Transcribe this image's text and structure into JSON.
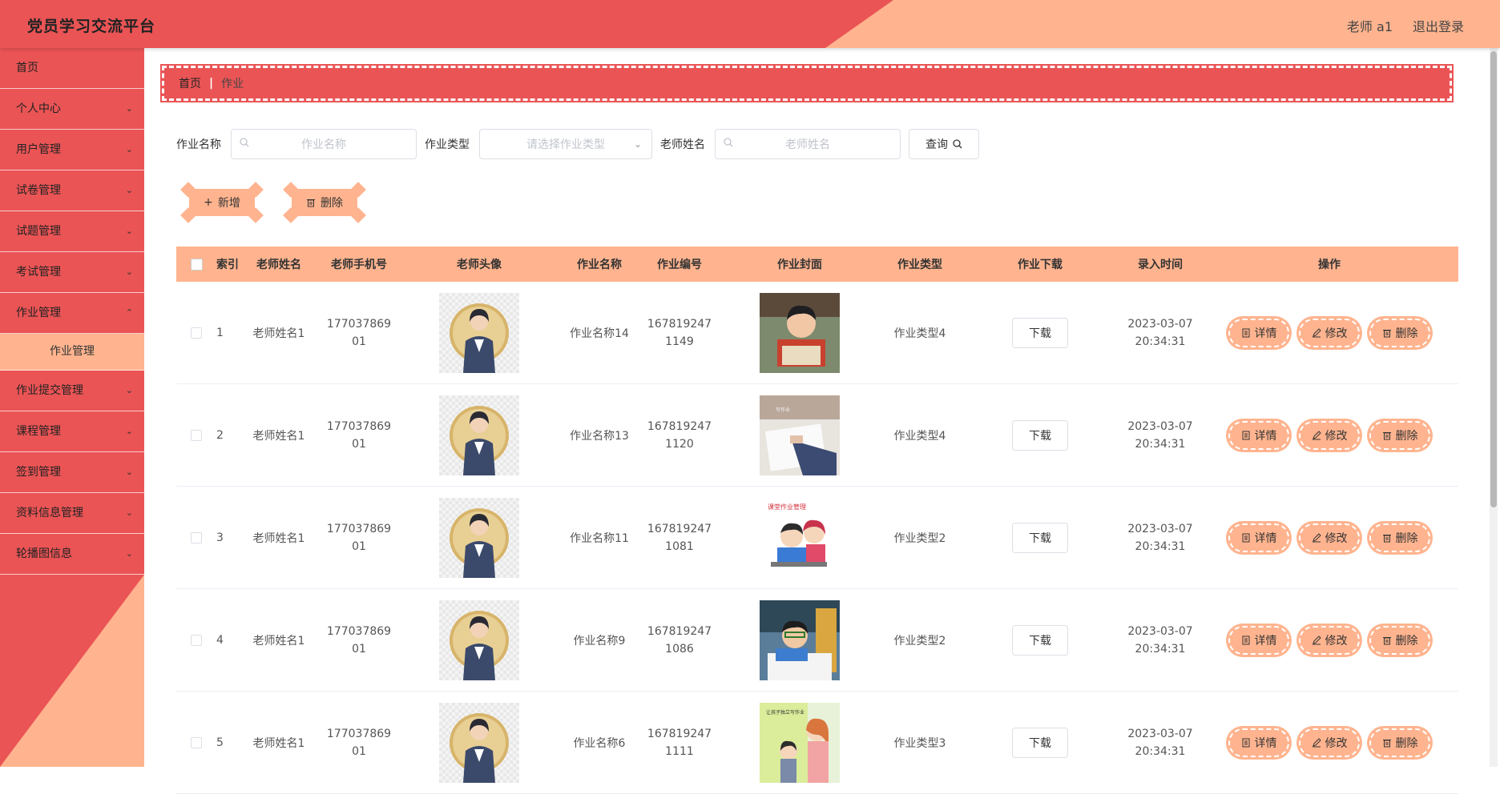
{
  "header": {
    "app_title": "党员学习交流平台",
    "user_label": "老师 a1",
    "logout_label": "退出登录"
  },
  "sidebar": {
    "items": [
      {
        "label": "首页",
        "has_children": false
      },
      {
        "label": "个人中心",
        "has_children": true
      },
      {
        "label": "用户管理",
        "has_children": true
      },
      {
        "label": "试卷管理",
        "has_children": true
      },
      {
        "label": "试题管理",
        "has_children": true
      },
      {
        "label": "考试管理",
        "has_children": true
      },
      {
        "label": "作业管理",
        "has_children": true,
        "expanded": true
      },
      {
        "label": "作业提交管理",
        "has_children": true
      },
      {
        "label": "课程管理",
        "has_children": true
      },
      {
        "label": "签到管理",
        "has_children": true
      },
      {
        "label": "资料信息管理",
        "has_children": true
      },
      {
        "label": "轮播图信息",
        "has_children": true
      }
    ],
    "active_sub_item": "作业管理"
  },
  "breadcrumb": {
    "home": "首页",
    "separator": "|",
    "current": "作业"
  },
  "search": {
    "hw_name_label": "作业名称",
    "hw_name_placeholder": "作业名称",
    "hw_type_label": "作业类型",
    "hw_type_placeholder": "请选择作业类型",
    "teacher_name_label": "老师姓名",
    "teacher_name_placeholder": "老师姓名",
    "query_label": "查询"
  },
  "actions": {
    "add_label": "新增",
    "delete_label": "删除"
  },
  "table": {
    "columns": [
      "索引",
      "老师姓名",
      "老师手机号",
      "老师头像",
      "作业名称",
      "作业编号",
      "作业封面",
      "作业类型",
      "作业下载",
      "录入时间",
      "操作"
    ],
    "download_label": "下载",
    "detail_label": "详情",
    "edit_label": "修改",
    "remove_label": "删除",
    "rows": [
      {
        "index": "1",
        "teacher": "老师姓名1",
        "phone": "177037869\n01",
        "hw_name": "作业名称14",
        "hw_no": "167819247\n1149",
        "hw_type": "作业类型4",
        "time": "2023-03-07\n20:34:31",
        "cover": "cover-boy-reading"
      },
      {
        "index": "2",
        "teacher": "老师姓名1",
        "phone": "177037869\n01",
        "hw_name": "作业名称13",
        "hw_no": "167819247\n1120",
        "hw_type": "作业类型4",
        "time": "2023-03-07\n20:34:31",
        "cover": "cover-writing-desk"
      },
      {
        "index": "3",
        "teacher": "老师姓名1",
        "phone": "177037869\n01",
        "hw_name": "作业名称11",
        "hw_no": "167819247\n1081",
        "hw_type": "作业类型2",
        "time": "2023-03-07\n20:34:31",
        "cover": "cover-cartoon-kids"
      },
      {
        "index": "4",
        "teacher": "老师姓名1",
        "phone": "177037869\n01",
        "hw_name": "作业名称9",
        "hw_no": "167819247\n1086",
        "hw_type": "作业类型2",
        "time": "2023-03-07\n20:34:31",
        "cover": "cover-boy-studying"
      },
      {
        "index": "5",
        "teacher": "老师姓名1",
        "phone": "177037869\n01",
        "hw_name": "作业名称6",
        "hw_no": "167819247\n1111",
        "hw_type": "作业类型3",
        "time": "2023-03-07\n20:34:31",
        "cover": "cover-mother-child"
      }
    ]
  },
  "colors": {
    "primary_red": "#ea5455",
    "accent_peach": "#ffb48f"
  }
}
